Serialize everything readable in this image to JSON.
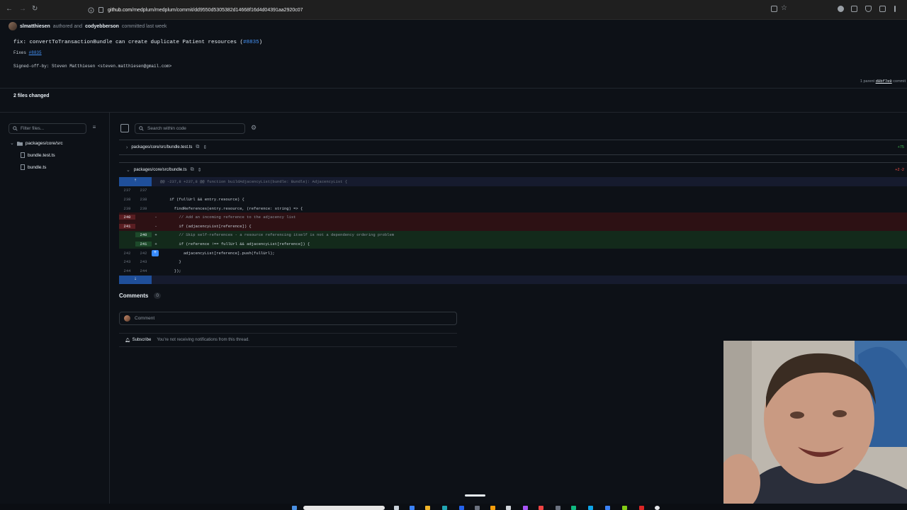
{
  "browser": {
    "url_host": "github.com",
    "url_path": "/medplum/medplum/commit/dd9550d5305382d14668f16d4d04391aa2920c07"
  },
  "commit": {
    "author": "slmatthiesen",
    "authored_text": "authored and",
    "committer": "codyebberson",
    "committed_text": "committed last week",
    "title": "fix: convertToTransactionBundle can create duplicate Patient resources (",
    "title_ref": "#8835",
    "title_end": ")",
    "fixes_label": "Fixes",
    "fixes_ref": "#8835",
    "signed_off": "Signed-off-by: Steven Matthiesen <steven.matthiesen@gmail.com>",
    "parent_label": "1 parent",
    "parent_sha": "d8bf7e9",
    "commit_label": "commit"
  },
  "files_changed": "2 files changed",
  "file_tree": {
    "filter_placeholder": "Filter files...",
    "folder": "packages/core/src",
    "files": [
      "bundle.test.ts",
      "bundle.ts"
    ]
  },
  "diff_toolbar": {
    "search_placeholder": "Search within code"
  },
  "files": [
    {
      "path": "packages/core/src/bundle.test.ts",
      "stat": "+75"
    },
    {
      "path": "packages/core/src/bundle.ts",
      "stat": "+2 -2"
    }
  ],
  "diff": {
    "hunk": "@@ -237,8 +237,8 @@ function buildAdjacencyList(bundle: Bundle): AdjacencyList {",
    "lines": [
      {
        "type": "ctx",
        "old": "237",
        "new": "237",
        "sign": "",
        "code": ""
      },
      {
        "type": "ctx",
        "old": "238",
        "new": "238",
        "sign": "",
        "code": "    if (fullUrl && entry.resource) {"
      },
      {
        "type": "ctx",
        "old": "239",
        "new": "239",
        "sign": "",
        "code": "      findReferences(entry.resource, (reference: string) => {"
      },
      {
        "type": "del",
        "old": "240",
        "new": "",
        "sign": "-",
        "code": "        // Add an incoming reference to the adjacency list"
      },
      {
        "type": "del",
        "old": "241",
        "new": "",
        "sign": "-",
        "code": "        if (adjacencyList[reference]) {"
      },
      {
        "type": "add",
        "old": "",
        "new": "240",
        "sign": "+",
        "code": "        // Skip self-references - a resource referencing itself is not a dependency ordering problem"
      },
      {
        "type": "add",
        "old": "",
        "new": "241",
        "sign": "+",
        "code": "        if (reference !== fullUrl && adjacencyList[reference]) {"
      },
      {
        "type": "ctx",
        "old": "242",
        "new": "242",
        "sign": "",
        "code": "          adjacencyList[reference].push(fullUrl);"
      },
      {
        "type": "ctx",
        "old": "243",
        "new": "243",
        "sign": "",
        "code": "        }"
      },
      {
        "type": "ctx",
        "old": "244",
        "new": "244",
        "sign": "",
        "code": "      });"
      }
    ]
  },
  "comments": {
    "title": "Comments",
    "count": "0",
    "placeholder": "Comment",
    "subscribe_label": "Subscribe",
    "notification_text": "You're not receiving notifications from this thread."
  }
}
